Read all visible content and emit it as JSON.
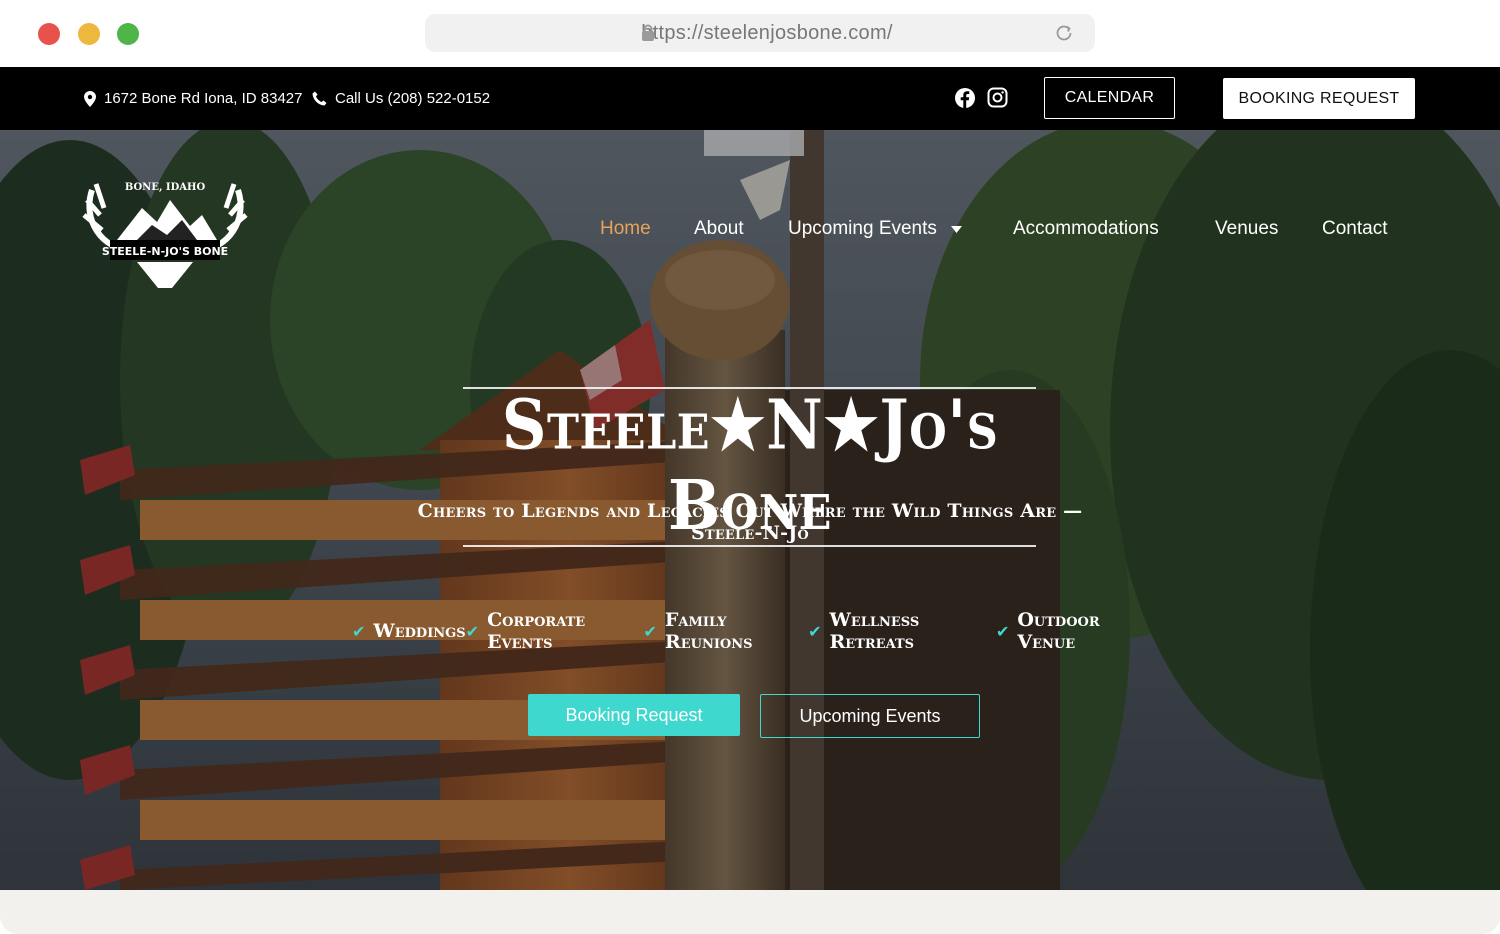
{
  "browser": {
    "url": "https://steelenjosbone.com/"
  },
  "topbar": {
    "address": "1672 Bone Rd Iona, ID 83427",
    "phone": "Call Us (208) 522-0152",
    "calendar_label": "CALENDAR",
    "booking_label": "BOOKING REQUEST"
  },
  "logo": {
    "top_text": "BONE, IDAHO",
    "bottom_text": "STEELE-N-JO'S BONE"
  },
  "nav": {
    "items": [
      {
        "label": "Home",
        "active": true
      },
      {
        "label": "About"
      },
      {
        "label": "Upcoming Events",
        "has_dropdown": true
      },
      {
        "label": "Accommodations"
      },
      {
        "label": "Venues"
      },
      {
        "label": "Contact"
      }
    ]
  },
  "hero": {
    "title": "Steele★N★Jo's Bone",
    "tagline": "Cheers to Legends and Legacies Out Where the Wild Things Are — Steele-N-Jo",
    "services": [
      "Weddings",
      "Corporate Events",
      "Family Reunions",
      "Wellness Retreats",
      "Outdoor Venue"
    ],
    "primary_button": "Booking Request",
    "secondary_button": "Upcoming Events"
  },
  "colors": {
    "accent": "#3fd8cf",
    "nav_active": "#e9a25a",
    "topbar_bg": "#000000"
  }
}
